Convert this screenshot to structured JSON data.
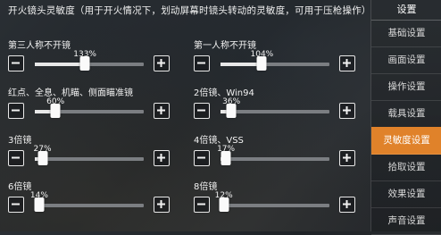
{
  "header": "开火镜头灵敏度（用于开火情况下，划动屏幕时镜头转动的灵敏度，可用于压枪操作）",
  "sensitivity_items": [
    {
      "label": "第三人称不开镜",
      "value": "133%",
      "level": 0.46
    },
    {
      "label": "第一人称不开镜",
      "value": "104%",
      "level": 0.38
    },
    {
      "label": "红点、全息、机瞄、侧面瞄准镜",
      "value": "60%",
      "level": 0.19
    },
    {
      "label": "2倍镜、Win94",
      "value": "36%",
      "level": 0.1
    },
    {
      "label": "3倍镜",
      "value": "27%",
      "level": 0.07
    },
    {
      "label": "4倍镜、VSS",
      "value": "17%",
      "level": 0.05
    },
    {
      "label": "6倍镜",
      "value": "14%",
      "level": 0.04
    },
    {
      "label": "8倍镜",
      "value": "12%",
      "level": 0.03
    }
  ],
  "sidebar": {
    "title": "设置",
    "items": [
      {
        "label": "基础设置",
        "active": false
      },
      {
        "label": "画面设置",
        "active": false
      },
      {
        "label": "操作设置",
        "active": false
      },
      {
        "label": "载具设置",
        "active": false
      },
      {
        "label": "灵敏度设置",
        "active": true
      },
      {
        "label": "拾取设置",
        "active": false
      },
      {
        "label": "效果设置",
        "active": false
      },
      {
        "label": "声音设置",
        "active": false
      }
    ]
  },
  "icons": {
    "decrease": "minus-icon",
    "increase": "plus-icon"
  },
  "colors": {
    "accent": "#e0822a",
    "track": "#7b7e82",
    "fill": "#e8e8e8"
  }
}
